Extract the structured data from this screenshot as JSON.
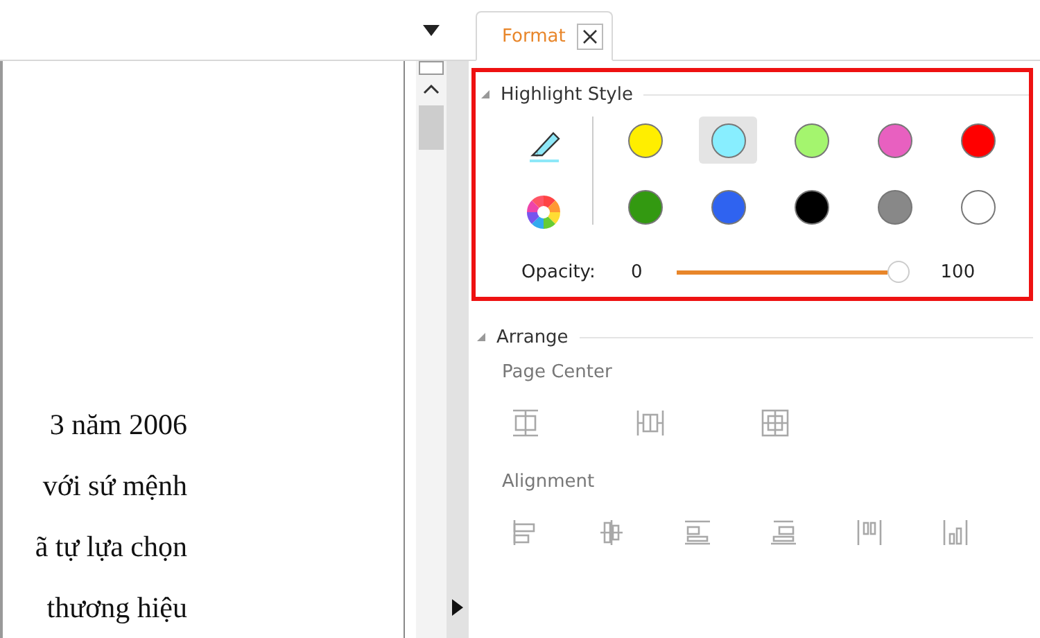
{
  "toolbar": {
    "tab": {
      "label": "Format",
      "selected": true
    }
  },
  "document": {
    "lines": [
      "3 năm 2006",
      "với sứ mệnh",
      "ã tự lựa chọn",
      "thương hiệu"
    ]
  },
  "highlight_style": {
    "title": "Highlight Style",
    "expanded": true,
    "swatches": [
      {
        "color": "#ffee00",
        "selected": false
      },
      {
        "color": "#88eeff",
        "selected": true
      },
      {
        "color": "#a4f56e",
        "selected": false
      },
      {
        "color": "#e860c0",
        "selected": false
      },
      {
        "color": "#ff0000",
        "selected": false
      },
      {
        "color": "#339911",
        "selected": false
      },
      {
        "color": "#2f63f0",
        "selected": false
      },
      {
        "color": "#000000",
        "selected": false
      },
      {
        "color": "#888888",
        "selected": false
      },
      {
        "color": "#ffffff",
        "selected": false
      }
    ],
    "opacity": {
      "label": "Opacity:",
      "min": "0",
      "max": "100",
      "level": 1
    }
  },
  "arrange": {
    "title": "Arrange",
    "expanded": true,
    "groups": [
      {
        "label": "Page Center",
        "icons": [
          {
            "kind": "center-horizontal"
          },
          {
            "kind": "center-vertical"
          },
          {
            "kind": "center-both"
          }
        ]
      },
      {
        "label": "Alignment",
        "icons": [
          {
            "kind": "left"
          },
          {
            "kind": "center"
          },
          {
            "kind": "top"
          },
          {
            "kind": "bottom"
          },
          {
            "kind": "distribute-h"
          },
          {
            "kind": "distribute-v"
          }
        ]
      }
    ]
  }
}
